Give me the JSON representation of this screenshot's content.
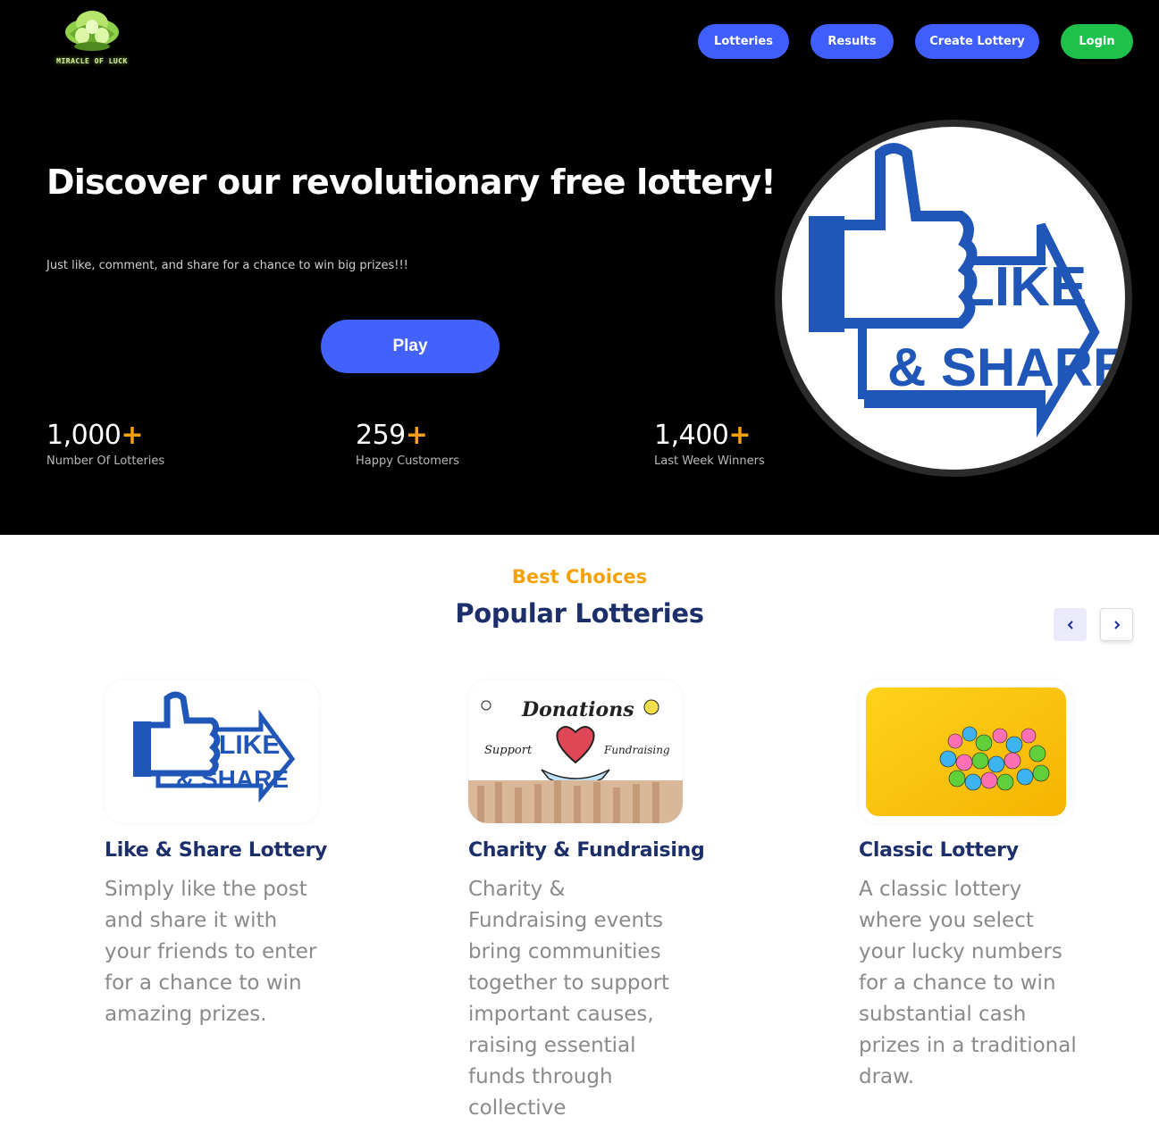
{
  "brand": {
    "logo_text": "MIRACLE OF LUCK"
  },
  "nav": {
    "lotteries": "Lotteries",
    "results": "Results",
    "create_lottery": "Create Lottery",
    "login": "Login"
  },
  "hero": {
    "title": "Discover our revolutionary free lottery!",
    "subtitle": "Just like, comment, and share for a chance to win big prizes!!!",
    "play_label": "Play",
    "image_text_top": "LIKE",
    "image_text_bottom": "& SHARE"
  },
  "stats": [
    {
      "value": "1,000",
      "plus": "+",
      "label": "Number Of Lotteries"
    },
    {
      "value": "259",
      "plus": "+",
      "label": "Happy Customers"
    },
    {
      "value": "1,400",
      "plus": "+",
      "label": "Last Week Winners"
    }
  ],
  "popular": {
    "eyebrow": "Best Choices",
    "heading": "Popular Lotteries",
    "cards": [
      {
        "title": "Like & Share Lottery",
        "description": "Simply like the post and share it with your friends to enter for a chance to win amazing prizes.",
        "img_text_top": "LIKE",
        "img_text_bottom": "& SHARE"
      },
      {
        "title": "Charity & Fundraising",
        "description": "Charity & Fundraising events bring communities together to support important causes, raising essential funds through collective",
        "img_text_top": "Donations",
        "img_text_left": "Support",
        "img_text_right": "Fundraising"
      },
      {
        "title": "Classic Lottery",
        "description": "A classic lottery where you select your lucky numbers for a chance to win substantial cash prizes in a traditional draw."
      }
    ]
  },
  "colors": {
    "accent_blue": "#3f5efb",
    "login_green": "#1ec14a",
    "orange": "#f5a10a",
    "navy": "#1d2f6b"
  }
}
